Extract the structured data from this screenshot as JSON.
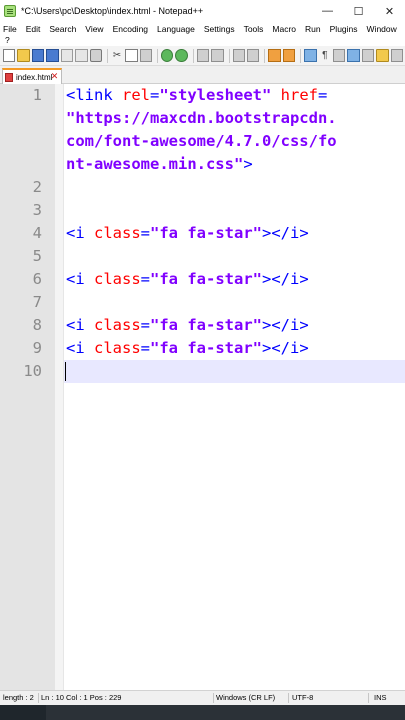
{
  "window": {
    "title": "*C:\\Users\\pc\\Desktop\\index.html - Notepad++",
    "minimize_glyph": "—",
    "maximize_glyph": "☐",
    "close_glyph": "✕"
  },
  "menu": {
    "items": [
      "File",
      "Edit",
      "Search",
      "View",
      "Encoding",
      "Language",
      "Settings",
      "Tools",
      "Macro",
      "Run",
      "Plugins",
      "Window"
    ],
    "overflow": "?"
  },
  "tab": {
    "label": "index.html",
    "close_glyph": "✕"
  },
  "editor": {
    "line_numbers": [
      "1",
      "",
      "",
      "2",
      "3",
      "4",
      "5",
      "6",
      "7",
      "8",
      "9",
      "10"
    ],
    "lines": [
      [
        {
          "t": "tag",
          "v": "<link "
        },
        {
          "t": "attr",
          "v": "rel"
        },
        {
          "t": "tag",
          "v": "="
        },
        {
          "t": "val",
          "v": "\"stylesheet\""
        },
        {
          "t": "tag",
          "v": " "
        },
        {
          "t": "attr",
          "v": "href"
        },
        {
          "t": "tag",
          "v": "="
        }
      ],
      [
        {
          "t": "val",
          "v": "\"https://maxcdn.bootstrapcdn."
        }
      ],
      [
        {
          "t": "val",
          "v": "com/font-awesome/4.7.0/css/fo"
        }
      ],
      [
        {
          "t": "val",
          "v": "nt-awesome.min.css\""
        },
        {
          "t": "tag",
          "v": ">"
        }
      ],
      [],
      [],
      [
        {
          "t": "tag",
          "v": "<i "
        },
        {
          "t": "attr",
          "v": "class"
        },
        {
          "t": "tag",
          "v": "="
        },
        {
          "t": "val",
          "v": "\"fa fa-star\""
        },
        {
          "t": "tag",
          "v": "></i>"
        }
      ],
      [],
      [
        {
          "t": "tag",
          "v": "<i "
        },
        {
          "t": "attr",
          "v": "class"
        },
        {
          "t": "tag",
          "v": "="
        },
        {
          "t": "val",
          "v": "\"fa fa-star\""
        },
        {
          "t": "tag",
          "v": "></i>"
        }
      ],
      [],
      [
        {
          "t": "tag",
          "v": "<i "
        },
        {
          "t": "attr",
          "v": "class"
        },
        {
          "t": "tag",
          "v": "="
        },
        {
          "t": "val",
          "v": "\"fa fa-star\""
        },
        {
          "t": "tag",
          "v": "></i>"
        }
      ],
      [
        {
          "t": "tag",
          "v": "<i "
        },
        {
          "t": "attr",
          "v": "class"
        },
        {
          "t": "tag",
          "v": "="
        },
        {
          "t": "val",
          "v": "\"fa fa-star\""
        },
        {
          "t": "tag",
          "v": "></i>"
        }
      ],
      []
    ],
    "visual_rows": [
      {
        "num": "1",
        "line": 0
      },
      {
        "num": "",
        "line": 1
      },
      {
        "num": "",
        "line": 2
      },
      {
        "num": "",
        "line": 3
      },
      {
        "num": "2",
        "line": 4
      },
      {
        "num": "3",
        "line": 5
      },
      {
        "num": "4",
        "line": 6
      },
      {
        "num": "5",
        "line": 7
      },
      {
        "num": "6",
        "line": 8
      },
      {
        "num": "7",
        "line": 9
      },
      {
        "num": "8",
        "line": 10
      },
      {
        "num": "9",
        "line": 11
      },
      {
        "num": "10",
        "line": 12
      }
    ],
    "current_line": "10",
    "colors": {
      "tag": "#0000ff",
      "attr": "#ff0000",
      "value": "#8000ff",
      "current_line_bg": "#e8e8ff"
    }
  },
  "status": {
    "length": "length : 2",
    "position": "Ln : 10   Col : 1   Pos : 229",
    "eol": "Windows (CR LF)",
    "encoding": "UTF-8",
    "mode": "INS"
  },
  "toolbar_icons": [
    "new-file-icon",
    "open-folder-icon",
    "save-icon",
    "save-all-icon",
    "close-icon",
    "close-all-icon",
    "print-icon",
    "cut-icon",
    "copy-icon",
    "paste-icon",
    "undo-icon",
    "redo-icon",
    "find-icon",
    "replace-icon",
    "zoom-in-icon",
    "zoom-out-icon",
    "sync-v-icon",
    "sync-h-icon",
    "word-wrap-icon",
    "all-chars-icon",
    "indent-guide-icon",
    "doc-map-icon",
    "function-list-icon",
    "folder-workspace-icon",
    "record-macro-icon"
  ]
}
